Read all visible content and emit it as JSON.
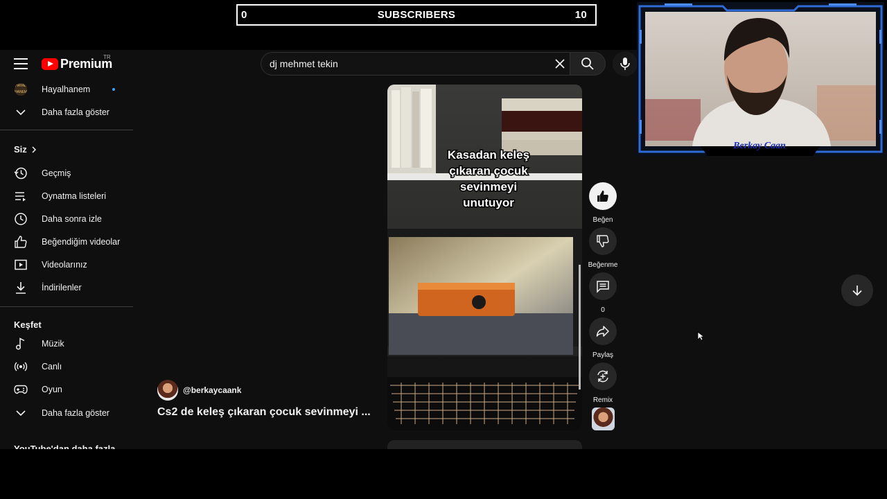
{
  "overlay": {
    "subscribers_label": "SUBSCRIBERS",
    "subscribers_current": "0",
    "subscribers_goal": "10",
    "webcam_name": "Berkay Caan"
  },
  "masthead": {
    "logo_text": "Premium",
    "country_code": "TR",
    "search_value": "dj mehmet tekin",
    "icons": [
      "menu-icon",
      "clear-icon",
      "search-icon",
      "mic-icon"
    ]
  },
  "sidebar": {
    "subscriptions": [
      {
        "label": "Hayalhanem",
        "icon": "channel-avatar",
        "avatar_text": "HAYAL HANEM",
        "new_content": true
      },
      {
        "label": "Daha fazla göster",
        "icon": "chevron-down-icon"
      }
    ],
    "you_header": "Siz",
    "you_items": [
      {
        "label": "Geçmiş",
        "icon": "history-icon"
      },
      {
        "label": "Oynatma listeleri",
        "icon": "playlist-icon"
      },
      {
        "label": "Daha sonra izle",
        "icon": "clock-icon"
      },
      {
        "label": "Beğendiğim videolar",
        "icon": "thumb-up-icon"
      },
      {
        "label": "Videolarınız",
        "icon": "video-icon"
      },
      {
        "label": "İndirilenler",
        "icon": "download-icon"
      }
    ],
    "explore_header": "Keşfet",
    "explore_items": [
      {
        "label": "Müzik",
        "icon": "music-icon"
      },
      {
        "label": "Canlı",
        "icon": "live-icon"
      },
      {
        "label": "Oyun",
        "icon": "gamepad-icon"
      },
      {
        "label": "Daha fazla göster",
        "icon": "chevron-down-icon"
      }
    ],
    "more_header": "YouTube'dan daha fazla"
  },
  "short": {
    "channel": "@berkaycaank",
    "title": "Cs2 de keleş çıkaran çocuk sevinmeyi ...",
    "overlay_text_lines": [
      "Kasadan keleş",
      "çıkaran çocuk",
      "sevinmeyi",
      "unutuyor"
    ],
    "actions": {
      "like": "Beğen",
      "dislike": "Beğenme",
      "comments": "0",
      "share": "Paylaş",
      "remix": "Remix"
    }
  },
  "colors": {
    "background": "#0f0f0f",
    "brand_red": "#ff0000",
    "surface": "#272727",
    "text": "#f1f1f1",
    "new_dot": "#3ea6ff",
    "webcam_frame": "#2e6bd6"
  }
}
